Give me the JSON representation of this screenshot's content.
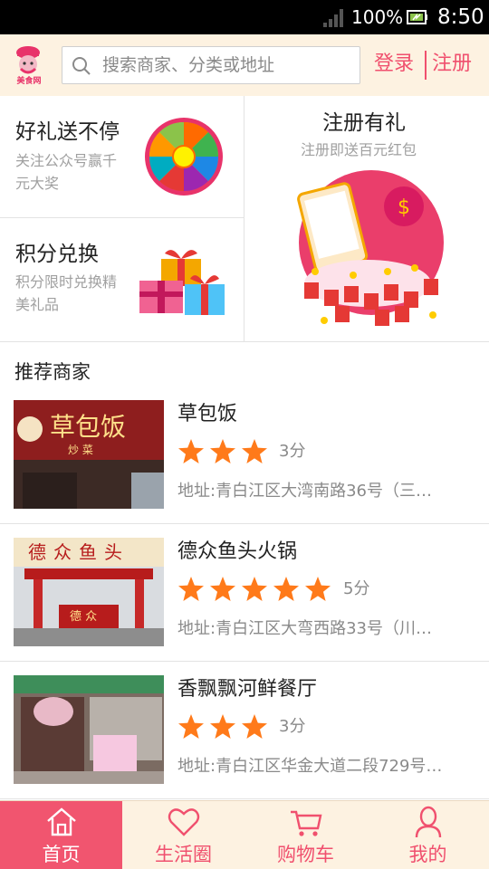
{
  "status_bar": {
    "battery": "100%",
    "time": "8:50"
  },
  "header": {
    "logo_text": "美食网",
    "search_placeholder": "搜索商家、分类或地址",
    "login": "登录",
    "register": "注册"
  },
  "promos": {
    "gift": {
      "title": "好礼送不停",
      "subtitle": "关注公众号赢千元大奖"
    },
    "points": {
      "title": "积分兑换",
      "subtitle": "积分限时兑换精美礼品"
    },
    "signup": {
      "title": "注册有礼",
      "subtitle": "注册即送百元红包"
    }
  },
  "recommended": {
    "title": "推荐商家",
    "merchants": [
      {
        "name": "草包饭",
        "rating": 3,
        "score": "3分",
        "address": "地址:青白江区大湾南路36号（三…",
        "sign": "草包饭",
        "sign_sub": "炒 菜"
      },
      {
        "name": "德众鱼头火锅",
        "rating": 5,
        "score": "5分",
        "address": "地址:青白江区大弯西路33号（川…",
        "sign": "德众鱼头",
        "sign_sub": "德 众"
      },
      {
        "name": "香飘飘河鲜餐厅",
        "rating": 3,
        "score": "3分",
        "address": "地址:青白江区华金大道二段729号…",
        "sign": "",
        "sign_sub": ""
      }
    ]
  },
  "tabs": [
    {
      "label": "首页",
      "icon": "home-icon",
      "active": true
    },
    {
      "label": "生活圈",
      "icon": "heart-icon",
      "active": false
    },
    {
      "label": "购物车",
      "icon": "cart-icon",
      "active": false
    },
    {
      "label": "我的",
      "icon": "person-icon",
      "active": false
    }
  ],
  "colors": {
    "accent": "#f0506e",
    "header_bg": "#fdf2e1",
    "star": "#ff7a1a"
  }
}
